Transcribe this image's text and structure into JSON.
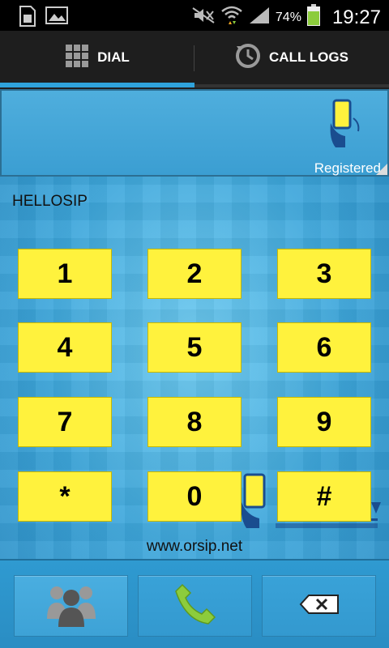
{
  "status_bar": {
    "battery_percent": "74%",
    "time": "19:27",
    "icons": [
      "sim-icon",
      "image-icon",
      "mute-icon",
      "wifi-icon",
      "signal-icon",
      "battery-icon"
    ]
  },
  "tabs": [
    {
      "label": "DIAL",
      "icon": "dialpad-grid-icon",
      "active": true
    },
    {
      "label": "CALL LOGS",
      "icon": "call-history-icon",
      "active": false
    }
  ],
  "display": {
    "registration_status": "Registered",
    "status_icon": "phone-registered-icon"
  },
  "account_name": "HELLOSIP",
  "keypad": {
    "keys": [
      "1",
      "2",
      "3",
      "4",
      "5",
      "6",
      "7",
      "8",
      "9",
      "*",
      "0",
      "#"
    ]
  },
  "website": "www.orsip.net",
  "bottom_bar": {
    "buttons": [
      "contacts-icon",
      "call-icon",
      "backspace-icon"
    ]
  },
  "colors": {
    "accent": "#2fa3dc",
    "key_background": "#fff23d",
    "call_green": "#8ccc3c"
  }
}
